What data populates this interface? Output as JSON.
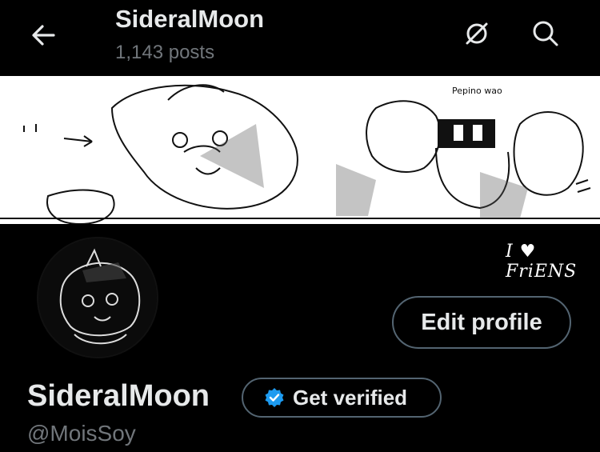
{
  "header": {
    "title": "SideralMoon",
    "posts_count": "1,143 posts",
    "back_icon": "arrow-left-icon",
    "sync_icon": "sync-off-icon",
    "search_icon": "search-icon"
  },
  "banner": {
    "caption_top": "Pepino wao",
    "caption_bottom": "I ♥ FriENS"
  },
  "profile": {
    "display_name": "SideralMoon",
    "handle": "@MoisSoy",
    "edit_button_label": "Edit profile",
    "verify_button_label": "Get verified",
    "verified_badge_color": "#1d9bf0"
  }
}
